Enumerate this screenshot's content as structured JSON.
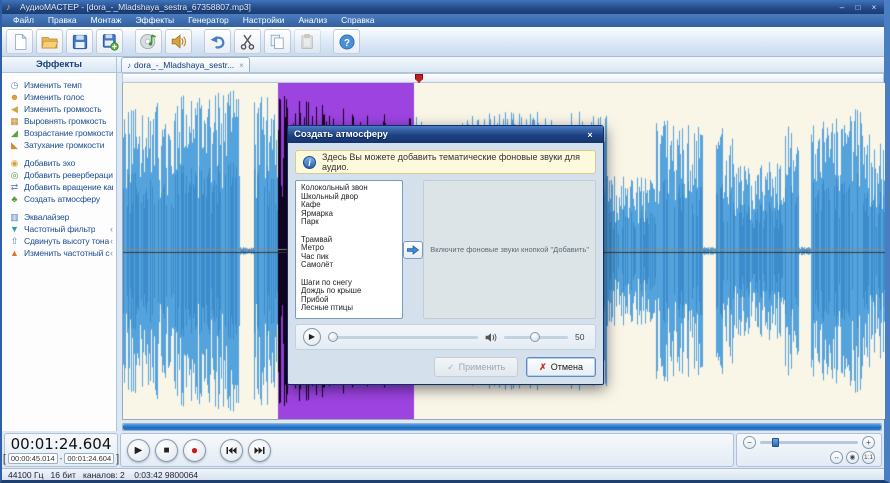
{
  "window": {
    "title": "АудиоМАСТЕР - [dora_-_Mladshaya_sestra_67358807.mp3]",
    "controls": {
      "minimize": "–",
      "maximize": "□",
      "close": "×"
    }
  },
  "menubar": [
    "Файл",
    "Правка",
    "Монтаж",
    "Эффекты",
    "Генератор",
    "Настройки",
    "Анализ",
    "Справка"
  ],
  "toolbar": {
    "buttons": [
      "new-file",
      "open-folder",
      "save",
      "save-fragment",
      "cd-audio",
      "sound-recording",
      "undo",
      "cut",
      "copy",
      "paste",
      "help"
    ]
  },
  "sidebar": {
    "header": "Эффекты",
    "groups": [
      [
        {
          "label": "Изменить темп",
          "icon": {
            "name": "tempo-clock-icon",
            "glyph": "◷",
            "color": "#5b84c4"
          }
        },
        {
          "label": "Изменить голос",
          "icon": {
            "name": "voice-icon",
            "glyph": "☻",
            "color": "#d98f2e"
          }
        },
        {
          "label": "Изменить громкость",
          "icon": {
            "name": "volume-icon",
            "glyph": "◀",
            "color": "#d9a33c"
          }
        },
        {
          "label": "Выровнять громкость",
          "icon": {
            "name": "normalize-icon",
            "glyph": "▦",
            "color": "#c8892a"
          }
        },
        {
          "label": "Возрастание громкости",
          "icon": {
            "name": "fade-in-icon",
            "glyph": "◢",
            "color": "#58a53a"
          }
        },
        {
          "label": "Затухание громкости",
          "icon": {
            "name": "fade-out-icon",
            "glyph": "◣",
            "color": "#d08a30"
          }
        }
      ],
      [
        {
          "label": "Добавить эхо",
          "icon": {
            "name": "echo-icon",
            "glyph": "◉",
            "color": "#d9a33c"
          }
        },
        {
          "label": "Добавить реверберацию",
          "icon": {
            "name": "reverb-icon",
            "glyph": "◎",
            "color": "#4a9a3a"
          }
        },
        {
          "label": "Добавить вращение каналов",
          "icon": {
            "name": "channel-rotation-icon",
            "glyph": "⇄",
            "color": "#6b89c4"
          }
        },
        {
          "label": "Создать атмосферу",
          "icon": {
            "name": "atmosphere-icon",
            "glyph": "♣",
            "color": "#4a9a3a"
          }
        }
      ],
      [
        {
          "label": "Эквалайзер",
          "icon": {
            "name": "equalizer-icon",
            "glyph": "▥",
            "color": "#4a7fc0"
          }
        },
        {
          "label": "Частотный фильтр",
          "icon": {
            "name": "frequency-filter-icon",
            "glyph": "▼",
            "color": "#2e9aa8"
          },
          "expandable": true
        },
        {
          "label": "Сдвинуть высоту тона",
          "icon": {
            "name": "pitch-shift-icon",
            "glyph": "⇧",
            "color": "#4a7fc0"
          },
          "expandable": true
        },
        {
          "label": "Изменить частотный спектр",
          "icon": {
            "name": "spectrum-icon",
            "glyph": "▲",
            "color": "#d9762e"
          },
          "expandable": true
        }
      ]
    ]
  },
  "tab": {
    "label": "dora_-_Mladshaya_sestr...",
    "close": "×"
  },
  "dialog": {
    "title": "Создать атмосферу",
    "close": "×",
    "info": "Здесь Вы можете добавить тематические фоновые звуки для аудио.",
    "sounds": [
      "Колокольный звон",
      "Школьный двор",
      "Кафе",
      "Ярмарка",
      "Парк",
      "",
      "Трамвай",
      "Метро",
      "Час пик",
      "Самолёт",
      "",
      "Шаги по снегу",
      "Дождь по крыше",
      "Прибой",
      "Лесные птицы"
    ],
    "hint": "Включите фоновые звуки кнопкой \"Добавить\"",
    "volume_value": "50",
    "apply_label": "Применить",
    "cancel_label": "Отмена"
  },
  "transport": {
    "buttons": [
      "play",
      "stop",
      "record",
      "previous",
      "next"
    ]
  },
  "time": {
    "current": "00:01:24.604",
    "bracket_open": "[",
    "selection_start": "00:00:45.014",
    "dash": "-",
    "selection_end": "00:01:24.604",
    "bracket_close": "]"
  },
  "zoom_controls": {
    "minus": "−",
    "plus": "+",
    "fit_width": "↔",
    "overview": "◉",
    "one_to_one": "1:1"
  },
  "statusbar": "44100 Гц   16 бит   каналов: 2    0:03:42 9800064",
  "colors": {
    "accent": "#2a5aa0",
    "wave_background": "#f9f5e7",
    "waveform_blue": "#55a3dd",
    "waveform_blue_dark": "#3c8ccb",
    "selection_purple": "#9d43e0",
    "selection_wave": "#140420",
    "playhead_red": "#c22020",
    "overview_blue": "#2a7fd4"
  }
}
